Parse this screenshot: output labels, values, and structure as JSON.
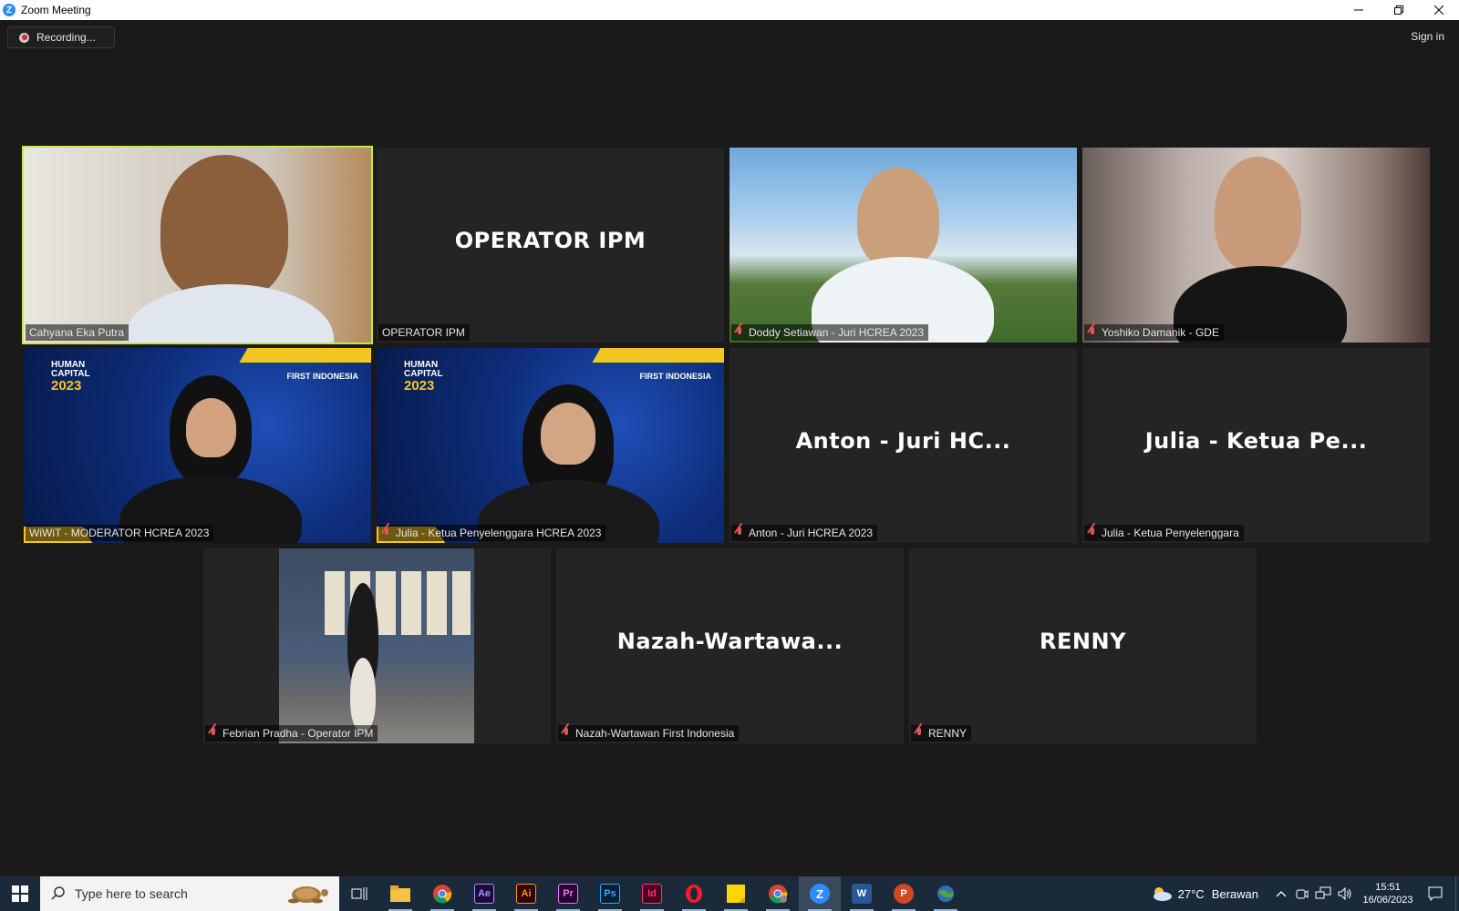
{
  "window": {
    "title": "Zoom Meeting"
  },
  "top": {
    "recording_label": "Recording...",
    "sign_in": "Sign in"
  },
  "participants": [
    {
      "name": "Cahyana Eka Putra",
      "display": "",
      "muted": false,
      "active": true
    },
    {
      "name": "OPERATOR IPM",
      "display": "OPERATOR IPM",
      "muted": false,
      "active": false
    },
    {
      "name": "Doddy Setiawan - Juri HCREA 2023",
      "display": "",
      "muted": true,
      "active": false
    },
    {
      "name": "Yoshiko Damanik - GDE",
      "display": "",
      "muted": true,
      "active": false
    },
    {
      "name": "WiWiT - MODERATOR HCREA 2023",
      "display": "",
      "muted": false,
      "active": false
    },
    {
      "name": "Julia - Ketua Penyelenggara HCREA 2023",
      "display": "",
      "muted": true,
      "active": false
    },
    {
      "name": "Anton - Juri HCREA 2023",
      "display": "Anton - Juri HC...",
      "muted": true,
      "active": false
    },
    {
      "name": "Julia - Ketua Penyelenggara",
      "display": "Julia - Ketua Pe...",
      "muted": true,
      "active": false
    },
    {
      "name": "Febrian Pradha - Operator IPM",
      "display": "",
      "muted": true,
      "active": false
    },
    {
      "name": "Nazah-Wartawan First Indonesia",
      "display": "Nazah-Wartawa...",
      "muted": true,
      "active": false
    },
    {
      "name": "RENNY",
      "display": "RENNY",
      "muted": true,
      "active": false
    }
  ],
  "virtual_background": {
    "brand_line1": "HUMAN",
    "brand_line2": "CAPITAL",
    "year": "2023",
    "publisher": "FIRST INDONESIA",
    "corner_year": "2023"
  },
  "taskbar": {
    "search_placeholder": "Type here to search",
    "apps": [
      {
        "icon": "file-explorer-icon",
        "label": ""
      },
      {
        "icon": "chrome-icon",
        "label": ""
      },
      {
        "icon": "after-effects-icon",
        "label": "Ae",
        "color": "#9999ff",
        "bg": "#1f0740"
      },
      {
        "icon": "illustrator-icon",
        "label": "Ai",
        "color": "#ff9a00",
        "bg": "#330000"
      },
      {
        "icon": "premiere-icon",
        "label": "Pr",
        "color": "#ea77ff",
        "bg": "#2a0033"
      },
      {
        "icon": "photoshop-icon",
        "label": "Ps",
        "color": "#31a8ff",
        "bg": "#001e36"
      },
      {
        "icon": "indesign-icon",
        "label": "Id",
        "color": "#ff3366",
        "bg": "#49021f"
      },
      {
        "icon": "opera-icon",
        "label": ""
      },
      {
        "icon": "sticky-notes-icon",
        "label": ""
      },
      {
        "icon": "chrome-profile-icon",
        "label": ""
      },
      {
        "icon": "zoom-icon",
        "label": ""
      },
      {
        "icon": "word-icon",
        "label": "W"
      },
      {
        "icon": "powerpoint-icon",
        "label": "P"
      },
      {
        "icon": "globe-app-icon",
        "label": ""
      }
    ],
    "weather_temp": "27°C",
    "weather_text": "Berawan",
    "time": "15:51",
    "date": "16/06/2023"
  }
}
